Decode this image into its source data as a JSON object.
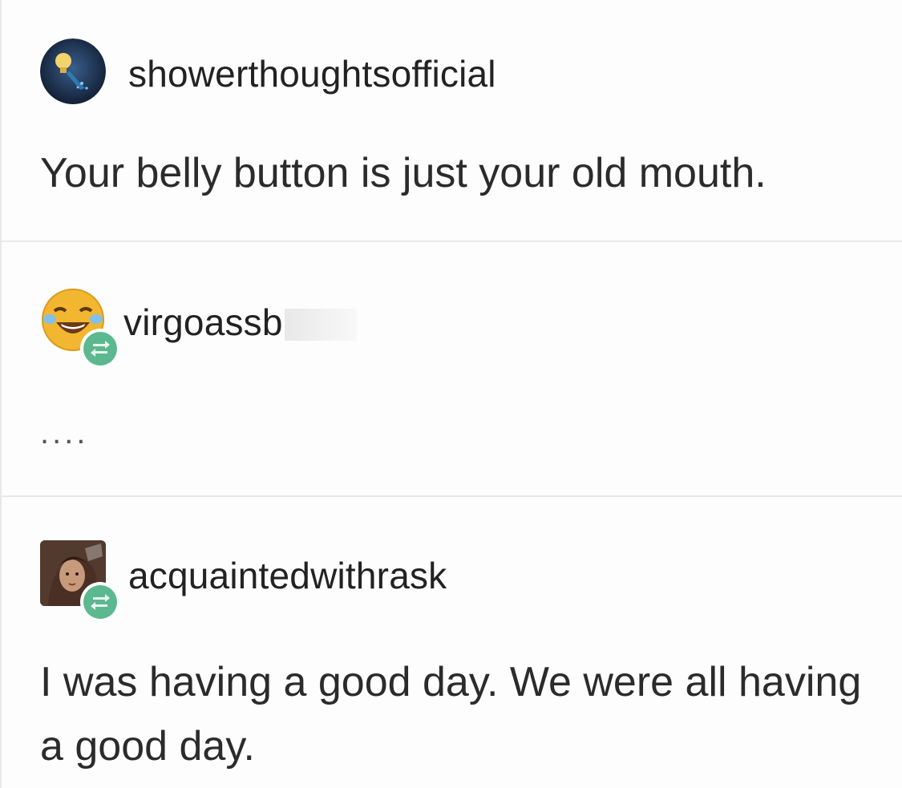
{
  "posts": [
    {
      "username": "showerthoughtsofficial",
      "avatar_icon": "lightbulb-avatar-icon",
      "reblog": false,
      "text": "Your belly button is just your old mouth."
    },
    {
      "username": "virgoassb",
      "avatar_icon": "laughing-crying-emoji-avatar-icon",
      "reblog": true,
      "text": "...."
    },
    {
      "username": "acquaintedwithrask",
      "avatar_icon": "portrait-painting-avatar-icon",
      "reblog": true,
      "text": "I was having a good day. We were all having a good day."
    }
  ],
  "colors": {
    "reblog_green": "#5cb88f",
    "divider": "#e9e9e9",
    "text": "#2b2b2b"
  }
}
